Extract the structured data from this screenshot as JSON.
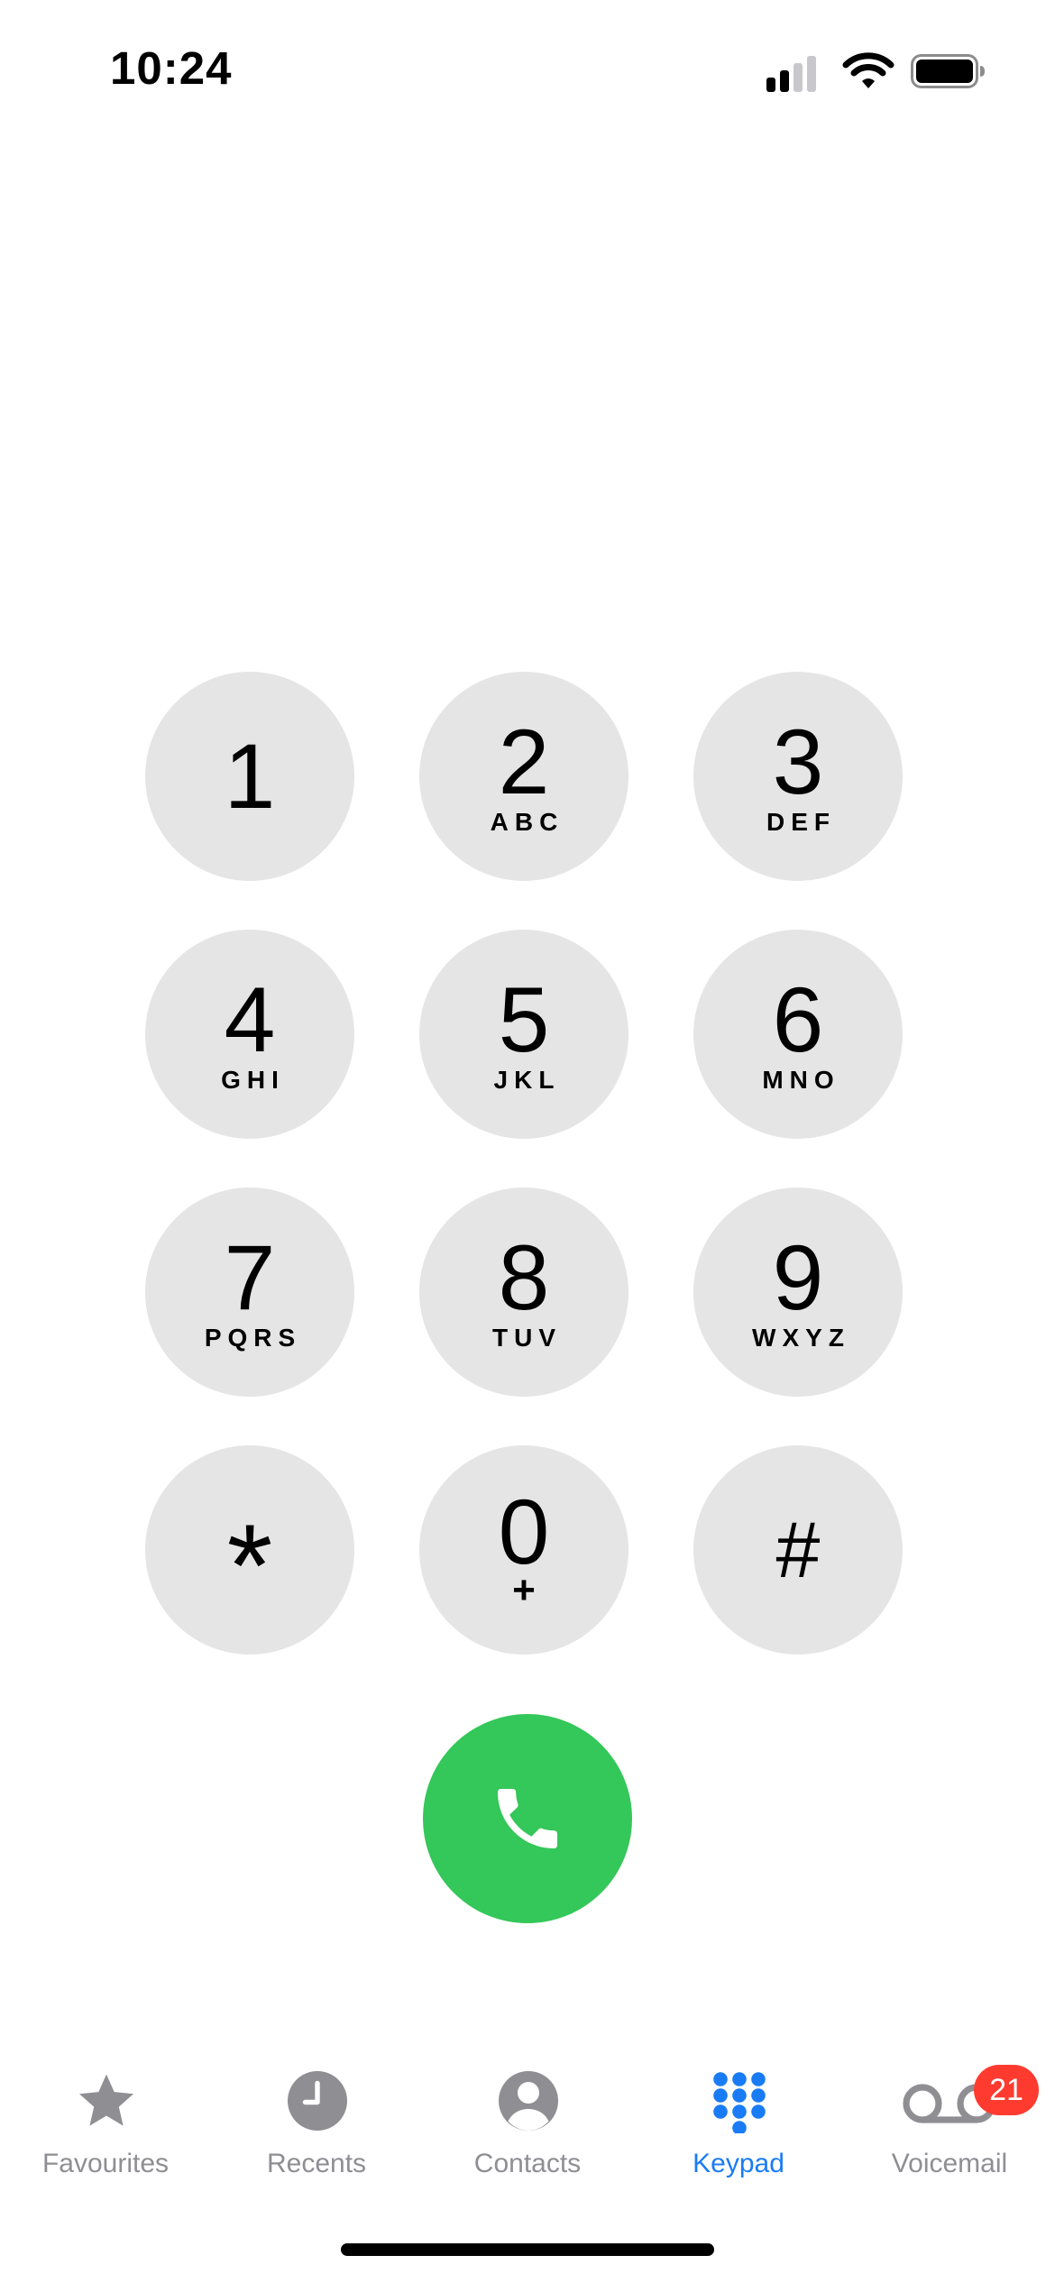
{
  "status_bar": {
    "time": "10:24"
  },
  "keypad": {
    "keys": [
      {
        "digit": "1",
        "letters": ""
      },
      {
        "digit": "2",
        "letters": "ABC"
      },
      {
        "digit": "3",
        "letters": "DEF"
      },
      {
        "digit": "4",
        "letters": "GHI"
      },
      {
        "digit": "5",
        "letters": "JKL"
      },
      {
        "digit": "6",
        "letters": "MNO"
      },
      {
        "digit": "7",
        "letters": "PQRS"
      },
      {
        "digit": "8",
        "letters": "TUV"
      },
      {
        "digit": "9",
        "letters": "WXYZ"
      },
      {
        "digit": "*",
        "letters": ""
      },
      {
        "digit": "0",
        "letters": "+"
      },
      {
        "digit": "#",
        "letters": ""
      }
    ]
  },
  "call_button": {
    "icon": "phone-icon"
  },
  "tab_bar": {
    "tabs": [
      {
        "label": "Favourites",
        "icon": "star-icon"
      },
      {
        "label": "Recents",
        "icon": "clock-icon"
      },
      {
        "label": "Contacts",
        "icon": "person-icon"
      },
      {
        "label": "Keypad",
        "icon": "keypad-icon"
      },
      {
        "label": "Voicemail",
        "icon": "voicemail-icon"
      }
    ],
    "active_tab": "Keypad",
    "voicemail_badge": "21"
  },
  "colors": {
    "accent": "#1a7cf5",
    "call": "#34c759",
    "badge": "#ff3b30",
    "key_background": "#e5e5e5",
    "inactive": "#8e8e93"
  }
}
